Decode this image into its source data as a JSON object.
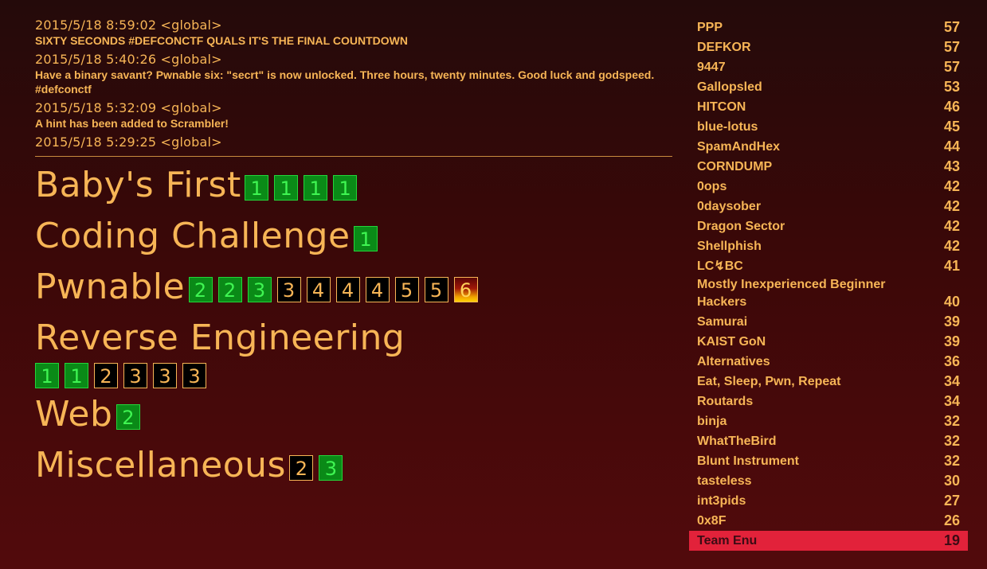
{
  "news": [
    {
      "time": "2015/5/18 8:59:02 <global>",
      "message": "SIXTY SECONDS #DEFCONCTF QUALS IT'S THE FINAL COUNTDOWN"
    },
    {
      "time": "2015/5/18 5:40:26 <global>",
      "message": "Have a binary savant? Pwnable six: \"secrt\" is now unlocked. Three hours, twenty minutes. Good luck and godspeed. #defconctf"
    },
    {
      "time": "2015/5/18 5:32:09 <global>",
      "message": "A hint has been added to Scrambler!"
    },
    {
      "time": "2015/5/18 5:29:25 <global>",
      "message": ""
    }
  ],
  "categories": [
    {
      "name": "Baby's First",
      "challenges": [
        {
          "points": "1",
          "state": "solved"
        },
        {
          "points": "1",
          "state": "solved"
        },
        {
          "points": "1",
          "state": "solved"
        },
        {
          "points": "1",
          "state": "solved"
        }
      ]
    },
    {
      "name": "Coding Challenge",
      "challenges": [
        {
          "points": "1",
          "state": "solved"
        }
      ]
    },
    {
      "name": "Pwnable",
      "challenges": [
        {
          "points": "2",
          "state": "solved"
        },
        {
          "points": "2",
          "state": "solved"
        },
        {
          "points": "3",
          "state": "solved"
        },
        {
          "points": "3",
          "state": "open"
        },
        {
          "points": "4",
          "state": "open"
        },
        {
          "points": "4",
          "state": "open"
        },
        {
          "points": "4",
          "state": "open"
        },
        {
          "points": "5",
          "state": "open"
        },
        {
          "points": "5",
          "state": "open"
        },
        {
          "points": "6",
          "state": "hot"
        }
      ]
    },
    {
      "name": "Reverse Engineering",
      "wrap": true,
      "challenges": [
        {
          "points": "1",
          "state": "solved"
        },
        {
          "points": "1",
          "state": "solved"
        },
        {
          "points": "2",
          "state": "open"
        },
        {
          "points": "3",
          "state": "open"
        },
        {
          "points": "3",
          "state": "open"
        },
        {
          "points": "3",
          "state": "open"
        }
      ]
    },
    {
      "name": "Web",
      "challenges": [
        {
          "points": "2",
          "state": "solved"
        }
      ]
    },
    {
      "name": "Miscellaneous",
      "challenges": [
        {
          "points": "2",
          "state": "open"
        },
        {
          "points": "3",
          "state": "solved"
        }
      ]
    }
  ],
  "scoreboard": [
    {
      "team": "PPP",
      "score": "57"
    },
    {
      "team": "DEFKOR",
      "score": "57"
    },
    {
      "team": "9447",
      "score": "57"
    },
    {
      "team": "Gallopsled",
      "score": "53"
    },
    {
      "team": "HITCON",
      "score": "46"
    },
    {
      "team": "blue-lotus",
      "score": "45"
    },
    {
      "team": "SpamAndHex",
      "score": "44"
    },
    {
      "team": "CORNDUMP",
      "score": "43"
    },
    {
      "team": "0ops",
      "score": "42"
    },
    {
      "team": "0daysober",
      "score": "42"
    },
    {
      "team": "Dragon Sector",
      "score": "42"
    },
    {
      "team": "Shellphish",
      "score": "42"
    },
    {
      "team": "LC↯BC",
      "score": "41"
    },
    {
      "team": "Mostly Inexperienced Beginner Hackers",
      "score": "40"
    },
    {
      "team": "Samurai",
      "score": "39"
    },
    {
      "team": "KAIST GoN",
      "score": "39"
    },
    {
      "team": "Alternatives",
      "score": "36"
    },
    {
      "team": "Eat, Sleep, Pwn, Repeat",
      "score": "34"
    },
    {
      "team": "Routards",
      "score": "34"
    },
    {
      "team": "binja",
      "score": "32"
    },
    {
      "team": "WhatTheBird",
      "score": "32"
    },
    {
      "team": "Blunt Instrument",
      "score": "32"
    },
    {
      "team": "tasteless",
      "score": "30"
    },
    {
      "team": "int3pids",
      "score": "27"
    },
    {
      "team": "0x8F",
      "score": "26"
    },
    {
      "team": "Team Enu",
      "score": "19",
      "highlight": true
    }
  ],
  "colors": {
    "accent": "#f7b556",
    "solved": "#0a8a17",
    "highlight": "#e2223a"
  }
}
